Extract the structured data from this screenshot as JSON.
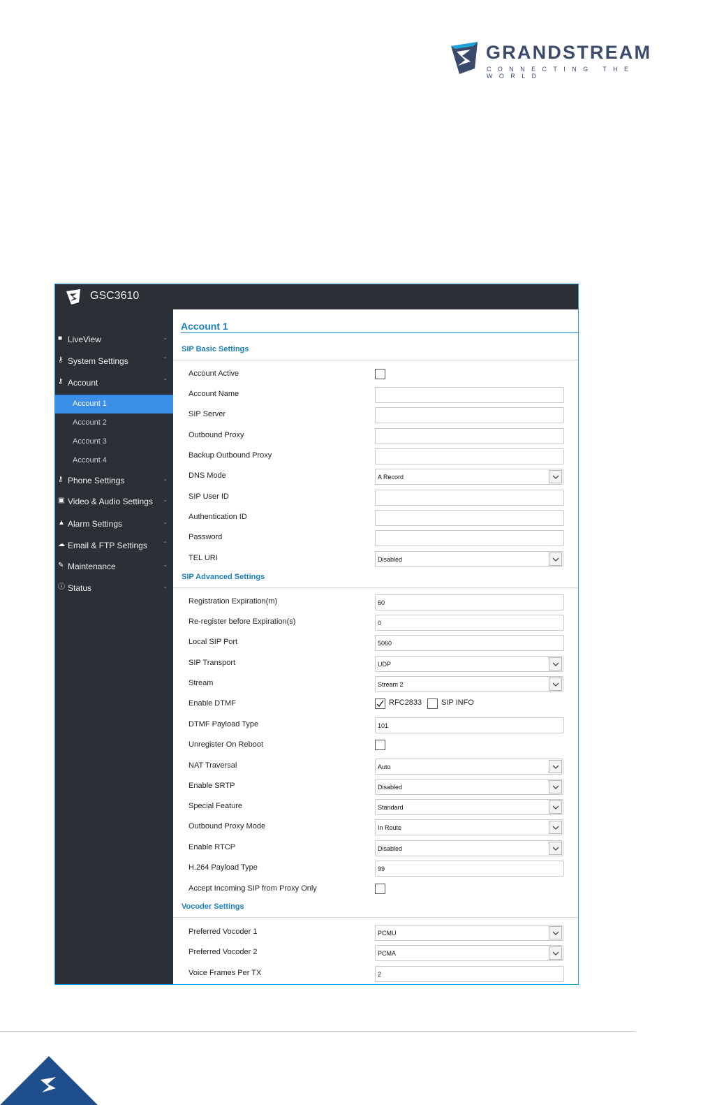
{
  "brand": {
    "name": "GRANDSTREAM",
    "tagline": "CONNECTING THE WORLD",
    "logo_icon": "grandstream-logo-icon",
    "colors": {
      "navy": "#3b4a6b",
      "blue": "#1a7fc1"
    }
  },
  "app": {
    "title": "GSC3610"
  },
  "sidebar": {
    "items": [
      {
        "label": "LiveView",
        "icon": "camera-icon",
        "chev": "⌄"
      },
      {
        "label": "System Settings",
        "icon": "key-icon",
        "chev": "⌃"
      },
      {
        "label": "Account",
        "icon": "key-icon",
        "chev": "⌃"
      },
      {
        "label": "Phone Settings",
        "icon": "key-icon",
        "chev": "⌄"
      },
      {
        "label": "Video & Audio Settings",
        "icon": "video-audio-icon",
        "chev": "⌄"
      },
      {
        "label": "Alarm Settings",
        "icon": "bell-icon",
        "chev": "⌄"
      },
      {
        "label": "Email & FTP Settings",
        "icon": "cloud-icon",
        "chev": "⌃"
      },
      {
        "label": "Maintenance",
        "icon": "wrench-icon",
        "chev": "⌄"
      },
      {
        "label": "Status",
        "icon": "info-icon",
        "chev": "⌄"
      }
    ],
    "sub_items": [
      {
        "label": "Account 1",
        "active": true
      },
      {
        "label": "Account 2"
      },
      {
        "label": "Account 3"
      },
      {
        "label": "Account 4"
      }
    ],
    "active_color": "#3a8ee6",
    "bg_color": "#2b2f36"
  },
  "main": {
    "title": "Account 1",
    "sections": {
      "basic": "SIP Basic Settings",
      "advanced": "SIP Advanced Settings",
      "vocoder": "Vocoder Settings"
    },
    "fields": {
      "account_active": {
        "label": "Account Active",
        "checked": false
      },
      "account_name": {
        "label": "Account Name",
        "value": ""
      },
      "sip_server": {
        "label": "SIP Server",
        "value": ""
      },
      "outbound_proxy": {
        "label": "Outbound Proxy",
        "value": ""
      },
      "backup_outbound_proxy": {
        "label": "Backup Outbound Proxy",
        "value": ""
      },
      "dns_mode": {
        "label": "DNS Mode",
        "value": "A Record"
      },
      "sip_user_id": {
        "label": "SIP User ID",
        "value": ""
      },
      "authentication_id": {
        "label": "Authentication ID",
        "value": ""
      },
      "password": {
        "label": "Password",
        "value": ""
      },
      "tel_uri": {
        "label": "TEL URI",
        "value": "Disabled"
      },
      "registration_expiration": {
        "label": "Registration Expiration(m)",
        "value": "60"
      },
      "reregister_before_expiration": {
        "label": "Re-register before Expiration(s)",
        "value": "0"
      },
      "local_sip_port": {
        "label": "Local SIP Port",
        "value": "5060"
      },
      "sip_transport": {
        "label": "SIP Transport",
        "value": "UDP"
      },
      "stream": {
        "label": "Stream",
        "value": "Stream 2"
      },
      "enable_dtmf": {
        "label": "Enable DTMF",
        "opt1": "RFC2833",
        "opt1_checked": true,
        "opt2": "SIP INFO",
        "opt2_checked": false
      },
      "dtmf_payload_type": {
        "label": "DTMF Payload Type",
        "value": "101"
      },
      "unregister_on_reboot": {
        "label": "Unregister On Reboot",
        "checked": false
      },
      "nat_traversal": {
        "label": "NAT Traversal",
        "value": "Auto"
      },
      "enable_srtp": {
        "label": "Enable SRTP",
        "value": "Disabled"
      },
      "special_feature": {
        "label": "Special Feature",
        "value": "Standard"
      },
      "outbound_proxy_mode": {
        "label": "Outbound Proxy Mode",
        "value": "In Route"
      },
      "enable_rtcp": {
        "label": "Enable RTCP",
        "value": "Disabled"
      },
      "h264_payload_type": {
        "label": "H.264 Payload Type",
        "value": "99"
      },
      "accept_incoming_sip": {
        "label": "Accept Incoming SIP from Proxy Only",
        "checked": false
      },
      "preferred_vocoder_1": {
        "label": "Preferred Vocoder 1",
        "value": "PCMU"
      },
      "preferred_vocoder_2": {
        "label": "Preferred Vocoder 2",
        "value": "PCMA"
      },
      "voice_frames_per_tx": {
        "label": "Voice Frames Per TX",
        "value": "2"
      }
    }
  }
}
